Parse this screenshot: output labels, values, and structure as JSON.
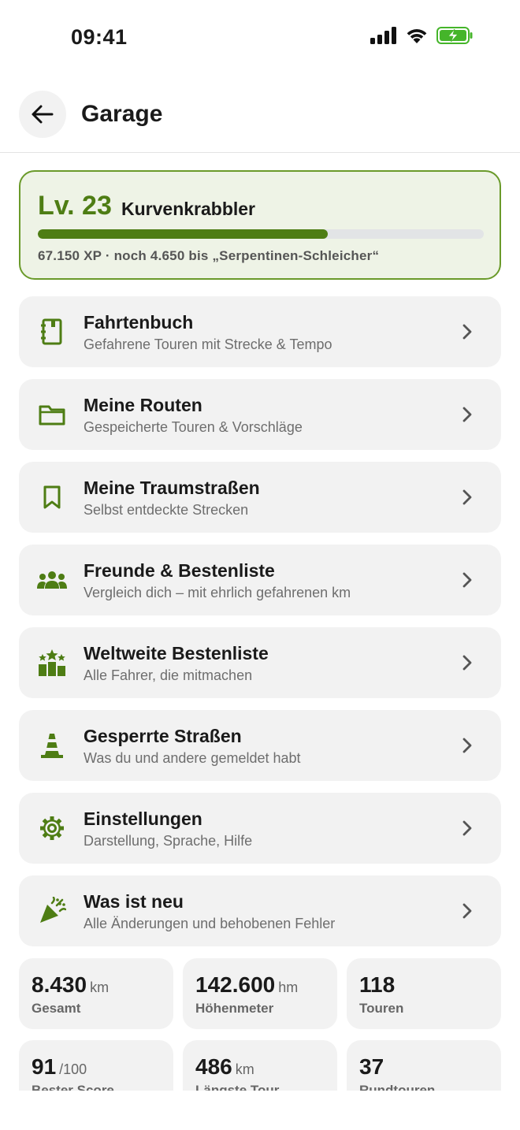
{
  "status_bar": {
    "time": "09:41",
    "icons": [
      "signal-icon",
      "wifi-icon",
      "battery-charging-icon"
    ]
  },
  "header": {
    "title": "Garage",
    "back_icon": "arrow-left-icon"
  },
  "colors": {
    "accent": "#4e7d14",
    "card_border": "#6a9a2a",
    "card_bg": "#eef3e6",
    "item_bg": "#f2f2f2"
  },
  "level": {
    "label": "Lv. 23",
    "name": "Kurvenkrabbler",
    "progress": 0.65,
    "xp_text": "67.150 XP · noch 4.650 bis „Serpentinen-Schleicher“"
  },
  "menu": [
    {
      "icon": "logbook-icon",
      "title": "Fahrtenbuch",
      "subtitle": "Gefahrene Touren mit Strecke & Tempo"
    },
    {
      "icon": "folder-icon",
      "title": "Meine Routen",
      "subtitle": "Gespeicherte Touren & Vorschläge"
    },
    {
      "icon": "bookmark-icon",
      "title": "Meine Traumstraßen",
      "subtitle": "Selbst entdeckte Strecken"
    },
    {
      "icon": "group-icon",
      "title": "Freunde & Bestenliste",
      "subtitle": "Vergleich dich – mit ehrlich gefahrenen km"
    },
    {
      "icon": "leaderboard-stars-icon",
      "title": "Weltweite Bestenliste",
      "subtitle": "Alle Fahrer, die mitmachen"
    },
    {
      "icon": "traffic-cone-icon",
      "title": "Gesperrte Straßen",
      "subtitle": "Was du und andere gemeldet habt"
    },
    {
      "icon": "gear-icon",
      "title": "Einstellungen",
      "subtitle": "Darstellung, Sprache, Hilfe"
    },
    {
      "icon": "party-popper-icon",
      "title": "Was ist neu",
      "subtitle": "Alle Änderungen und behobenen Fehler"
    }
  ],
  "stats": [
    {
      "value": "8.430",
      "unit": "km",
      "label": "Gesamt"
    },
    {
      "value": "142.600",
      "unit": "hm",
      "label": "Höhenmeter"
    },
    {
      "value": "118",
      "unit": "",
      "label": "Touren"
    },
    {
      "value": "91",
      "unit": "/100",
      "label": "Bester Score"
    },
    {
      "value": "486",
      "unit": "km",
      "label": "Längste Tour"
    },
    {
      "value": "37",
      "unit": "",
      "label": "Rundtouren"
    }
  ]
}
